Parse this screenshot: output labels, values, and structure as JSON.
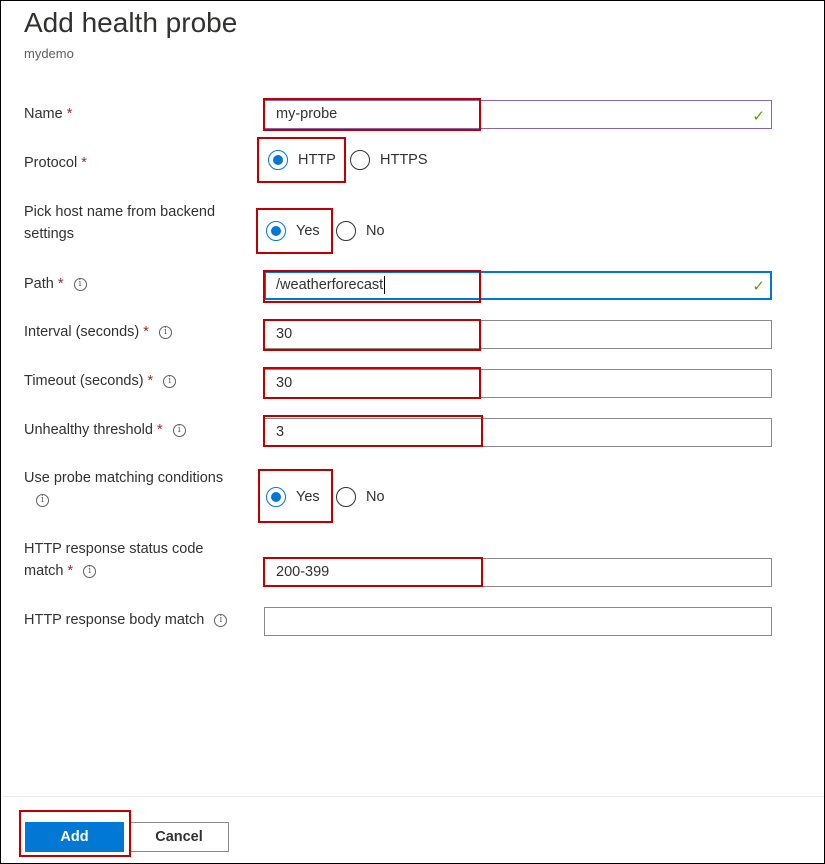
{
  "panel": {
    "title": "Add health probe",
    "subtitle": "mydemo"
  },
  "form": {
    "name": {
      "label": "Name",
      "required": "*",
      "value": "my-probe",
      "valid_icon": "✓"
    },
    "protocol": {
      "label": "Protocol",
      "required": "*",
      "options": [
        "HTTP",
        "HTTPS"
      ],
      "selected": "HTTP"
    },
    "pick_host": {
      "label_line1": "Pick host name from backend",
      "label_line2": "settings",
      "options": [
        "Yes",
        "No"
      ],
      "selected": "Yes"
    },
    "path": {
      "label": "Path",
      "required": "*",
      "value": "/weatherforecast",
      "valid_icon": "✓"
    },
    "interval": {
      "label": "Interval (seconds)",
      "required": "*",
      "value": "30"
    },
    "timeout": {
      "label": "Timeout (seconds)",
      "required": "*",
      "value": "30"
    },
    "unhealthy": {
      "label": "Unhealthy threshold",
      "required": "*",
      "value": "3"
    },
    "matching": {
      "label": "Use probe matching conditions",
      "options": [
        "Yes",
        "No"
      ],
      "selected": "Yes"
    },
    "status_code": {
      "label_line1": "HTTP response status code",
      "label_line2": "match",
      "required": "*",
      "value": "200-399"
    },
    "body_match": {
      "label": "HTTP response body match",
      "value": ""
    }
  },
  "footer": {
    "add_label": "Add",
    "cancel_label": "Cancel"
  },
  "icons": {
    "info": "i",
    "info_icon_name": "info-icon",
    "check_icon_name": "checkmark-icon"
  },
  "colors": {
    "accent": "#0078d4",
    "required": "#a4262c",
    "valid": "#57a300",
    "highlight": "#c00000"
  }
}
